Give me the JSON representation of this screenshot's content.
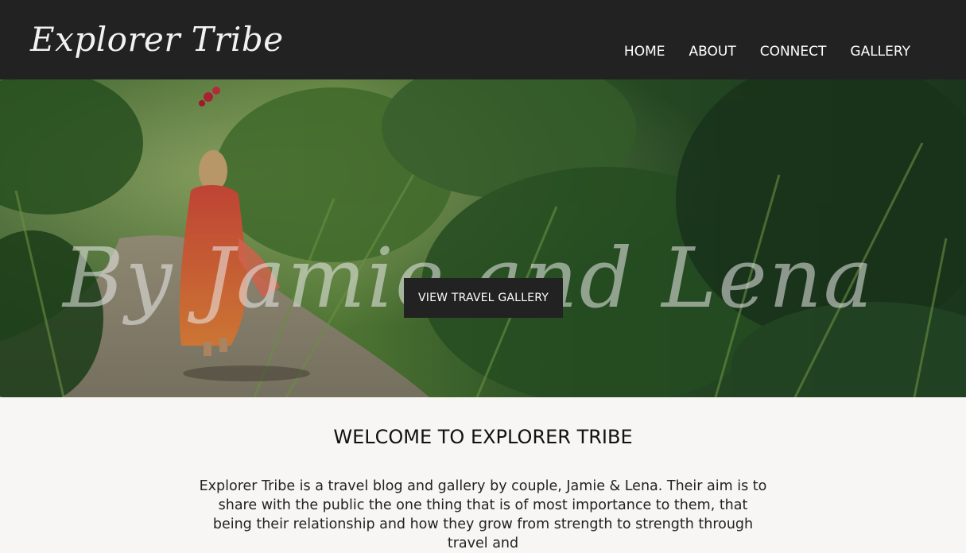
{
  "header": {
    "logo": "Explorer Tribe",
    "nav": [
      {
        "label": "HOME"
      },
      {
        "label": "ABOUT"
      },
      {
        "label": "CONNECT"
      },
      {
        "label": "GALLERY"
      }
    ]
  },
  "hero": {
    "title": "By Jamie and Lena",
    "button_label": "VIEW TRAVEL GALLERY"
  },
  "welcome": {
    "heading": "WELCOME TO EXPLORER TRIBE",
    "body": "Explorer Tribe is a travel blog and gallery by couple, Jamie & Lena. Their aim is to share with the public the one thing that is of most importance to them, that being their relationship and how they grow from strength to strength through travel and"
  }
}
